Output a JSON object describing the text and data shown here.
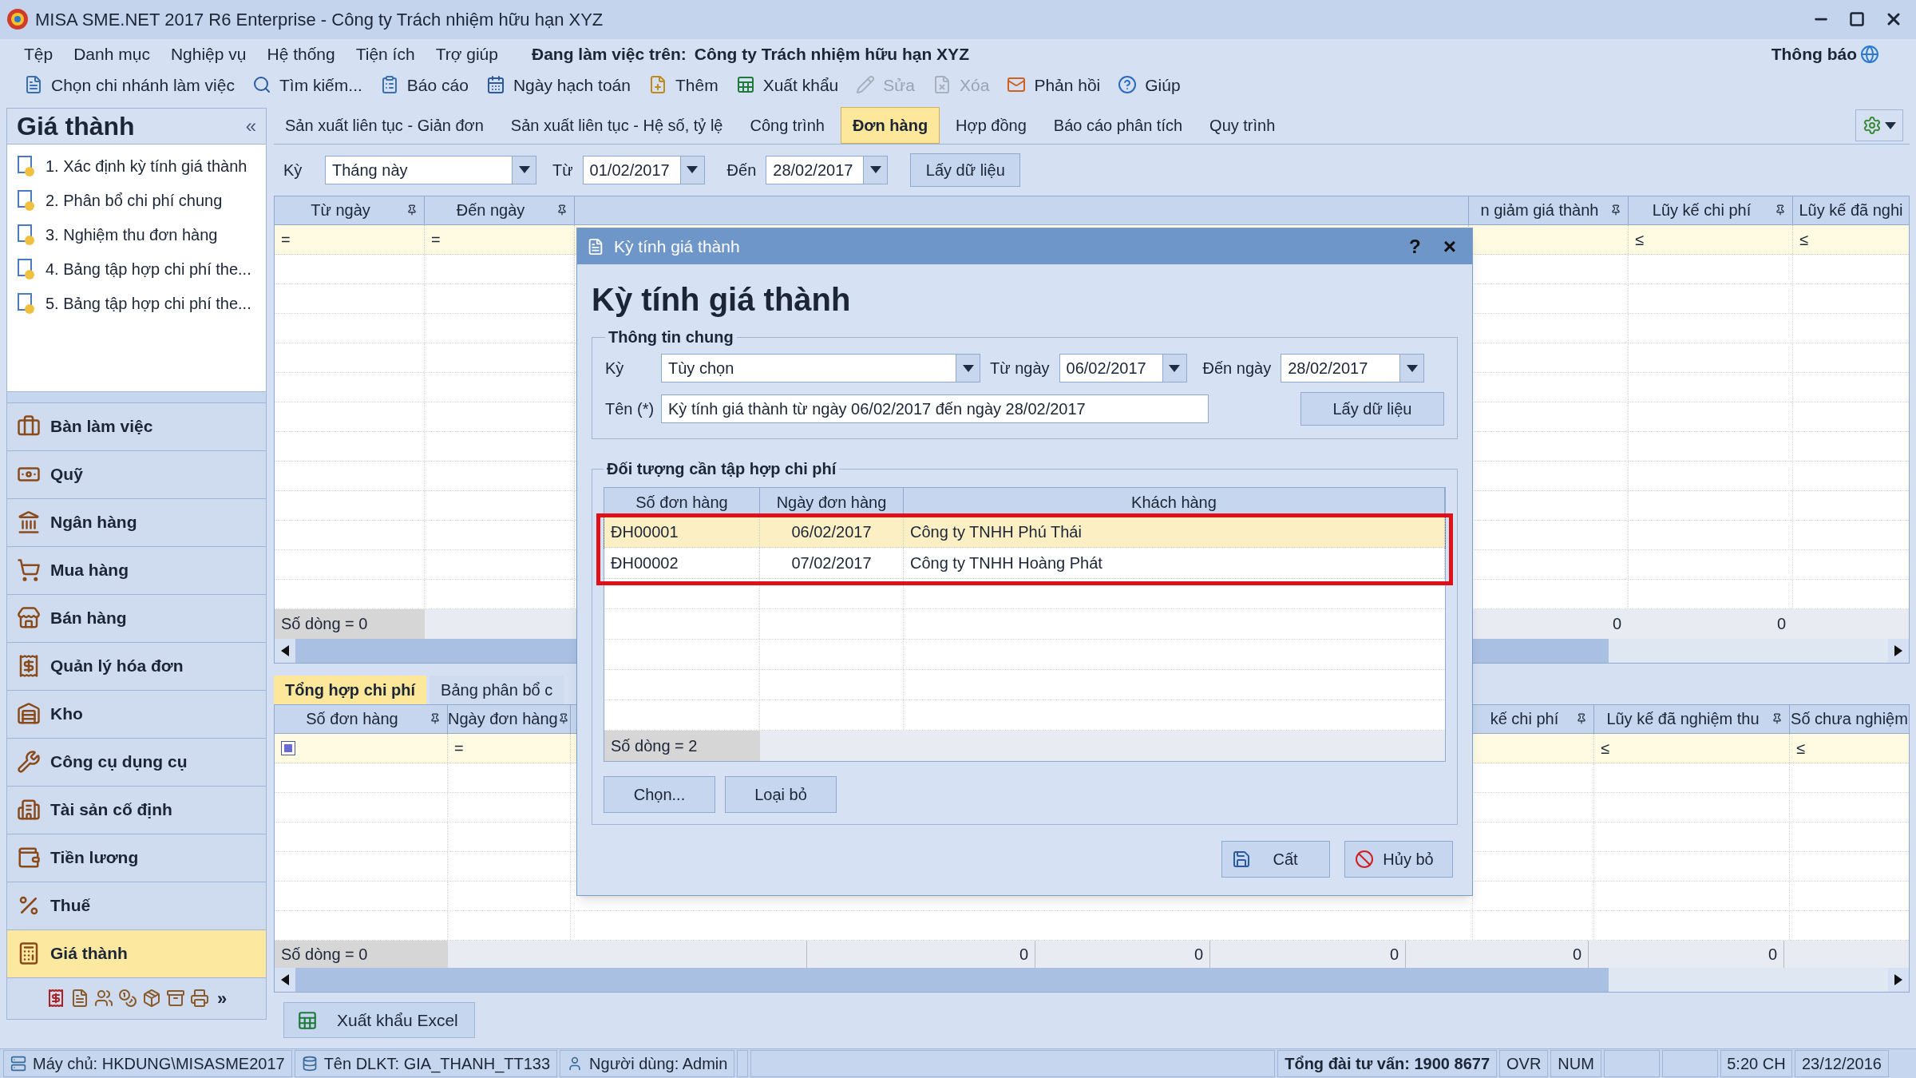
{
  "window": {
    "title": "MISA SME.NET 2017 R6 Enterprise - Công ty Trách nhiệm hữu hạn XYZ"
  },
  "menu": [
    "Tệp",
    "Danh mục",
    "Nghiệp vụ",
    "Hệ thống",
    "Tiện ích",
    "Trợ giúp"
  ],
  "workspace": {
    "label": "Đang làm việc trên:",
    "company": "Công ty Trách nhiệm hữu hạn XYZ"
  },
  "notification": "Thông báo",
  "toolbar": [
    {
      "label": "Chọn chi nhánh làm việc",
      "disabled": false
    },
    {
      "label": "Tìm kiếm...",
      "disabled": false
    },
    {
      "label": "Báo cáo",
      "disabled": false
    },
    {
      "label": "Ngày hạch toán",
      "disabled": false
    },
    {
      "label": "Thêm",
      "disabled": false
    },
    {
      "label": "Xuất khẩu",
      "disabled": false
    },
    {
      "label": "Sửa",
      "disabled": true
    },
    {
      "label": "Xóa",
      "disabled": true
    },
    {
      "label": "Phản hồi",
      "disabled": false
    },
    {
      "label": "Giúp",
      "disabled": false
    }
  ],
  "sidebar": {
    "title": "Giá thành",
    "collapse": "«",
    "more": "»",
    "tasks": [
      "1. Xác định kỳ tính giá thành",
      "2. Phân bổ chi phí chung",
      "3. Nghiệm thu đơn hàng",
      "4. Bảng tập hợp chi phí the...",
      "5. Bảng tập hợp chi phí the..."
    ],
    "modules": [
      {
        "label": "Bàn làm việc",
        "selected": false
      },
      {
        "label": "Quỹ",
        "selected": false
      },
      {
        "label": "Ngân hàng",
        "selected": false
      },
      {
        "label": "Mua hàng",
        "selected": false
      },
      {
        "label": "Bán hàng",
        "selected": false
      },
      {
        "label": "Quản lý hóa đơn",
        "selected": false
      },
      {
        "label": "Kho",
        "selected": false
      },
      {
        "label": "Công cụ dụng cụ",
        "selected": false
      },
      {
        "label": "Tài sản cố định",
        "selected": false
      },
      {
        "label": "Tiền lương",
        "selected": false
      },
      {
        "label": "Thuế",
        "selected": false
      },
      {
        "label": "Giá thành",
        "selected": true
      }
    ]
  },
  "tabs": [
    {
      "label": "Sản xuất liên tục - Giản đơn",
      "selected": false
    },
    {
      "label": "Sản xuất liên tục - Hệ số, tỷ lệ",
      "selected": false
    },
    {
      "label": "Công trình",
      "selected": false
    },
    {
      "label": "Đơn hàng",
      "selected": true
    },
    {
      "label": "Hợp đồng",
      "selected": false
    },
    {
      "label": "Báo cáo phân tích",
      "selected": false
    },
    {
      "label": "Quy trình",
      "selected": false
    }
  ],
  "filter": {
    "period_label": "Kỳ",
    "period": "Tháng này",
    "from_label": "Từ",
    "from": "01/02/2017",
    "to_label": "Đến",
    "to": "28/02/2017",
    "fetch_button": "Lấy dữ liệu"
  },
  "top_grid": {
    "columns_left": [
      {
        "label": "Từ ngày",
        "filter": {
          "kind": "symbol",
          "symbol": "="
        }
      },
      {
        "label": "Đến ngày",
        "filter": {
          "kind": "symbol",
          "symbol": "="
        }
      }
    ],
    "columns_right": [
      {
        "label": "n giảm giá thành",
        "total": "0"
      },
      {
        "label": "Lũy kế chi phí",
        "filter": {
          "kind": "symbol",
          "symbol": "≤"
        },
        "total": "0"
      },
      {
        "label": "Lũy kế đã nghi",
        "filter": {
          "kind": "symbol",
          "symbol": "≤"
        }
      }
    ],
    "row_count": "Số dòng = 0"
  },
  "bottom_tabs": [
    {
      "label": "Tổng hợp chi phí",
      "selected": true
    },
    {
      "label": "Bảng phân bổ c",
      "selected": false
    }
  ],
  "bottom_grid": {
    "columns_left": [
      {
        "label": "Số đơn hàng",
        "filter": {
          "kind": "checkbox"
        }
      },
      {
        "label": "Ngày đơn hàng",
        "filter": {
          "kind": "symbol",
          "symbol": "="
        }
      }
    ],
    "columns_right": [
      {
        "label": "kế chi phí"
      },
      {
        "label": "Lũy kế đã nghiệm thu",
        "filter": {
          "kind": "symbol",
          "symbol": "≤"
        }
      },
      {
        "label": "Số chưa nghiệm",
        "filter": {
          "kind": "symbol",
          "symbol": "≤"
        }
      }
    ],
    "row_count": "Số dòng = 0",
    "totals": [
      "0",
      "0",
      "0",
      "0",
      "0"
    ]
  },
  "export_button": "Xuất khẩu Excel",
  "dialog": {
    "title": "Kỳ tính giá thành",
    "help": "?",
    "close": "×",
    "heading": "Kỳ tính giá thành",
    "general": {
      "legend": "Thông tin chung",
      "period_label": "Kỳ",
      "period": "Tùy chọn",
      "from_label": "Từ ngày",
      "from": "06/02/2017",
      "to_label": "Đến ngày",
      "to": "28/02/2017",
      "name_label": "Tên (*)",
      "name": "Kỳ tính giá thành từ ngày 06/02/2017 đến ngày 28/02/2017",
      "fetch_button": "Lấy dữ liệu"
    },
    "objects": {
      "legend": "Đối tượng cần tập hợp chi phí",
      "columns": [
        "Số đơn hàng",
        "Ngày đơn hàng",
        "Khách hàng"
      ],
      "rows": [
        {
          "cells": [
            "ĐH00001",
            "06/02/2017",
            "Công ty TNHH Phú Thái"
          ],
          "selected": true
        },
        {
          "cells": [
            "ĐH00002",
            "07/02/2017",
            "Công ty TNHH Hoàng Phát"
          ],
          "selected": false
        }
      ],
      "row_count": "Số dòng = 2",
      "buttons": [
        "Chọn...",
        "Loại bỏ"
      ]
    },
    "buttons": [
      "Cất",
      "Hủy bỏ"
    ]
  },
  "status_bar": {
    "cells": [
      {
        "label": "Máy chủ: HKDUNG\\MISASME2017",
        "kind": "server"
      },
      {
        "label": "Tên DLKT: GIA_THANH_TT133",
        "kind": "database"
      },
      {
        "label": "Người dùng: Admin",
        "kind": "user"
      }
    ],
    "hotline": "Tổng đài tư vấn: 1900 8677",
    "indicators": [
      "OVR",
      "NUM"
    ],
    "time": "5:20 CH",
    "date": "23/12/2016"
  }
}
